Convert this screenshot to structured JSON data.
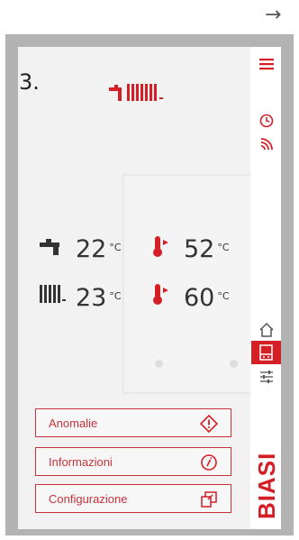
{
  "nav": {
    "arrow_glyph": "→"
  },
  "step_label": "3.",
  "temperatures": {
    "dhw": {
      "value": "22",
      "unit": "°C"
    },
    "heating": {
      "value": "23",
      "unit": "°C"
    },
    "dhw_flow": {
      "value": "52",
      "unit": "°C"
    },
    "heating_flow": {
      "value": "60",
      "unit": "°C"
    }
  },
  "buttons": {
    "anomalie": "Anomalie",
    "informazioni": "Informazioni",
    "configurazione": "Configurazione"
  },
  "brand": {
    "name": "BIASI",
    "color": "#d41f26"
  },
  "icons": {
    "menu": "hamburger-menu-icon",
    "clock": "clock-icon",
    "signal": "wifi-signal-icon",
    "home": "home-icon",
    "boiler": "boiler-icon",
    "settings": "settings-sliders-icon"
  },
  "colors": {
    "accent": "#d41f26",
    "frame": "#b3b3b3",
    "screen": "#f2f2f2"
  }
}
